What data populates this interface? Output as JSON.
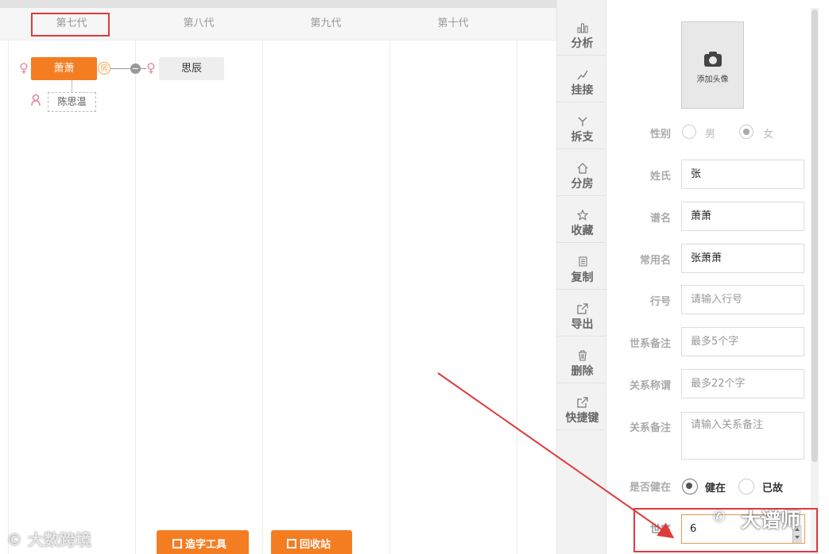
{
  "generations": [
    "第七代",
    "第八代",
    "第九代",
    "第十代"
  ],
  "tree": {
    "main_node": "萧萧",
    "main_badge": "房",
    "child_node": "思辰",
    "spouse_node": "陈思温"
  },
  "toolbar": {
    "items": [
      {
        "label": "分析",
        "icon": "bar-chart-icon"
      },
      {
        "label": "挂接",
        "icon": "link-icon"
      },
      {
        "label": "拆支",
        "icon": "split-icon"
      },
      {
        "label": "分房",
        "icon": "home-icon"
      },
      {
        "label": "收藏",
        "icon": "star-icon"
      },
      {
        "label": "复制",
        "icon": "copy-icon"
      },
      {
        "label": "导出",
        "icon": "export-icon"
      },
      {
        "label": "删除",
        "icon": "trash-icon"
      },
      {
        "label": "快捷键",
        "icon": "shortcut-icon"
      }
    ]
  },
  "panel": {
    "avatar_caption": "添加头像",
    "gender_label": "性别",
    "gender_male": "男",
    "gender_female": "女",
    "gender_selected": "女",
    "surname_label": "姓氏",
    "surname_value": "张",
    "pu_name_label": "谱名",
    "pu_name_value": "萧萧",
    "common_name_label": "常用名",
    "common_name_value": "张萧萧",
    "hang_label": "行号",
    "hang_placeholder": "请输入行号",
    "shixi_note_label": "世系备注",
    "shixi_note_placeholder": "最多5个字",
    "relation_title_label": "关系称谓",
    "relation_title_placeholder": "最多22个字",
    "relation_note_label": "关系备注",
    "relation_note_placeholder": "请输入关系备注",
    "alive_label": "是否健在",
    "alive_yes": "健在",
    "alive_no": "已故",
    "alive_selected": "健在",
    "seq_label": "世序",
    "seq_value": "6"
  },
  "bottom_buttons": {
    "make_char": "造字工具",
    "recycle": "回收站"
  },
  "watermarks": {
    "left": "大数跨境",
    "right": "大谱师"
  }
}
